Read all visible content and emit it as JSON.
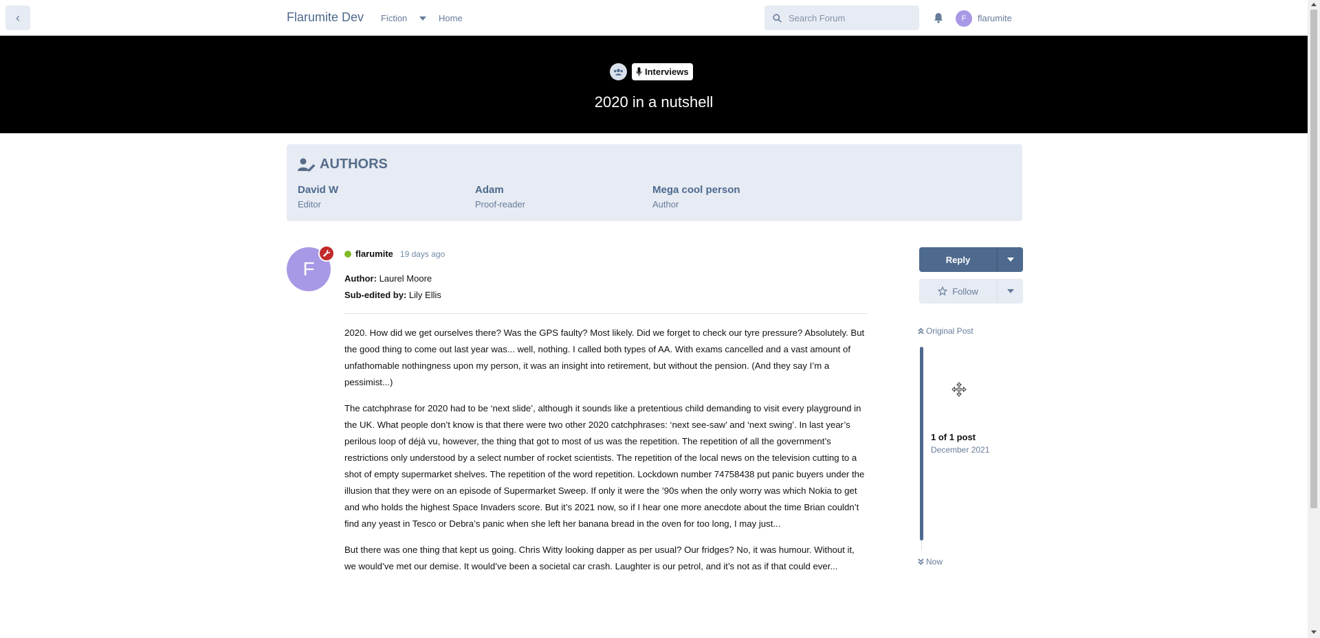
{
  "header": {
    "brand": "Flarumite Dev",
    "nav_fiction": "Fiction",
    "nav_home": "Home",
    "search_placeholder": "Search Forum",
    "user_initial": "F",
    "username": "flarumite"
  },
  "hero": {
    "tag_label": "Interviews",
    "title": "2020 in a nutshell"
  },
  "authors": {
    "heading": "AUTHORS",
    "items": [
      {
        "name": "David W",
        "role": "Editor"
      },
      {
        "name": "Adam",
        "role": "Proof-reader"
      },
      {
        "name": "Mega cool person",
        "role": "Author"
      }
    ]
  },
  "post": {
    "avatar_initial": "F",
    "username": "flarumite",
    "time": "19 days ago",
    "author_label": "Author:",
    "author_value": "Laurel Moore",
    "subedit_label": "Sub-edited by:",
    "subedit_value": "Lily Ellis",
    "paragraphs": [
      "2020. How did we get ourselves there? Was the GPS faulty? Most likely. Did we forget to check our tyre pressure? Absolutely. But the good thing to come out last year was... well, nothing. I called both types of AA. With exams cancelled and a vast amount of unfathomable nothingness upon my person, it was an insight into retirement, but without the pension. (And they say I’m a pessimist...)",
      "The catchphrase for 2020 had to be ‘next slide’, although it sounds like a pretentious child demanding to visit every playground in the UK. What people don’t know is that there were two other 2020 catchphrases: ‘next see-saw’ and ‘next swing’. In last year’s perilous loop of déjà vu, however, the thing that got to most of us was the repetition. The repetition of all the government’s restrictions only understood by a select number of rocket scientists. The repetition of the local news on the television cutting to a shot of empty supermarket shelves. The repetition of the word repetition. Lockdown number 74758438 put panic buyers under the illusion that they were on an episode of Supermarket Sweep. If only it were the ’90s when the only worry was which Nokia to get and who holds the highest Space Invaders score. But it’s 2021 now, so if I hear one more anecdote about the time Brian couldn’t find any yeast in Tesco or Debra’s panic when she left her banana bread in the oven for too long, I may just...",
      "But there was one thing that kept us going. Chris Witty looking dapper as per usual? Our fridges? No, it was humour. Without it, we would’ve met our demise. It would’ve been a societal car crash. Laughter is our petrol, and it’s not as if that could ever..."
    ]
  },
  "sidebar": {
    "reply_label": "Reply",
    "follow_label": "Follow",
    "original_post": "Original Post",
    "scrub_count": "1 of 1 post",
    "scrub_date": "December 2021",
    "now_label": "Now"
  },
  "colors": {
    "accent": "#4d698e",
    "secondary_bg": "#e7ebf3",
    "avatar": "#a998e6",
    "mod_badge": "#c12b2b",
    "online": "#7fba27"
  }
}
